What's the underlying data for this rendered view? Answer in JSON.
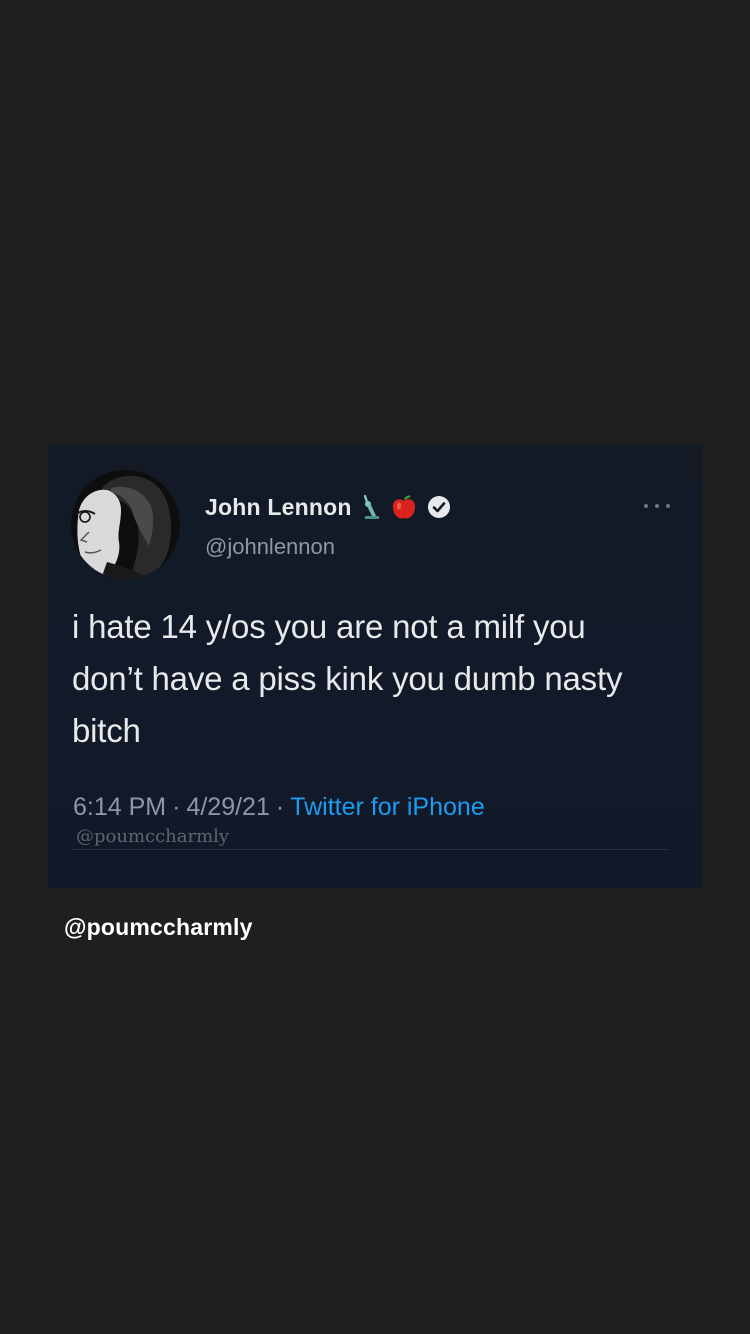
{
  "tweet": {
    "display_name": "John Lennon",
    "handle": "@johnlennon",
    "badges": [
      "statue-of-liberty-emoji",
      "red-apple-emoji",
      "verified-badge-icon"
    ],
    "text_lines": [
      "i hate 14 y/os you are not a milf you",
      "don’t have a piss kink you dumb nasty",
      "bitch"
    ],
    "time": "6:14 PM",
    "date": "4/29/21",
    "separator": "·",
    "source": "Twitter for iPhone",
    "watermark": "@poumccharmly",
    "colors": {
      "card_background": "#121a2a",
      "text": "#e7e9ea",
      "muted": "#8b98a5",
      "link": "#1d9bf0"
    }
  },
  "caption": {
    "text": "@poumccharmly"
  },
  "page": {
    "background": "#1f1f1f"
  }
}
